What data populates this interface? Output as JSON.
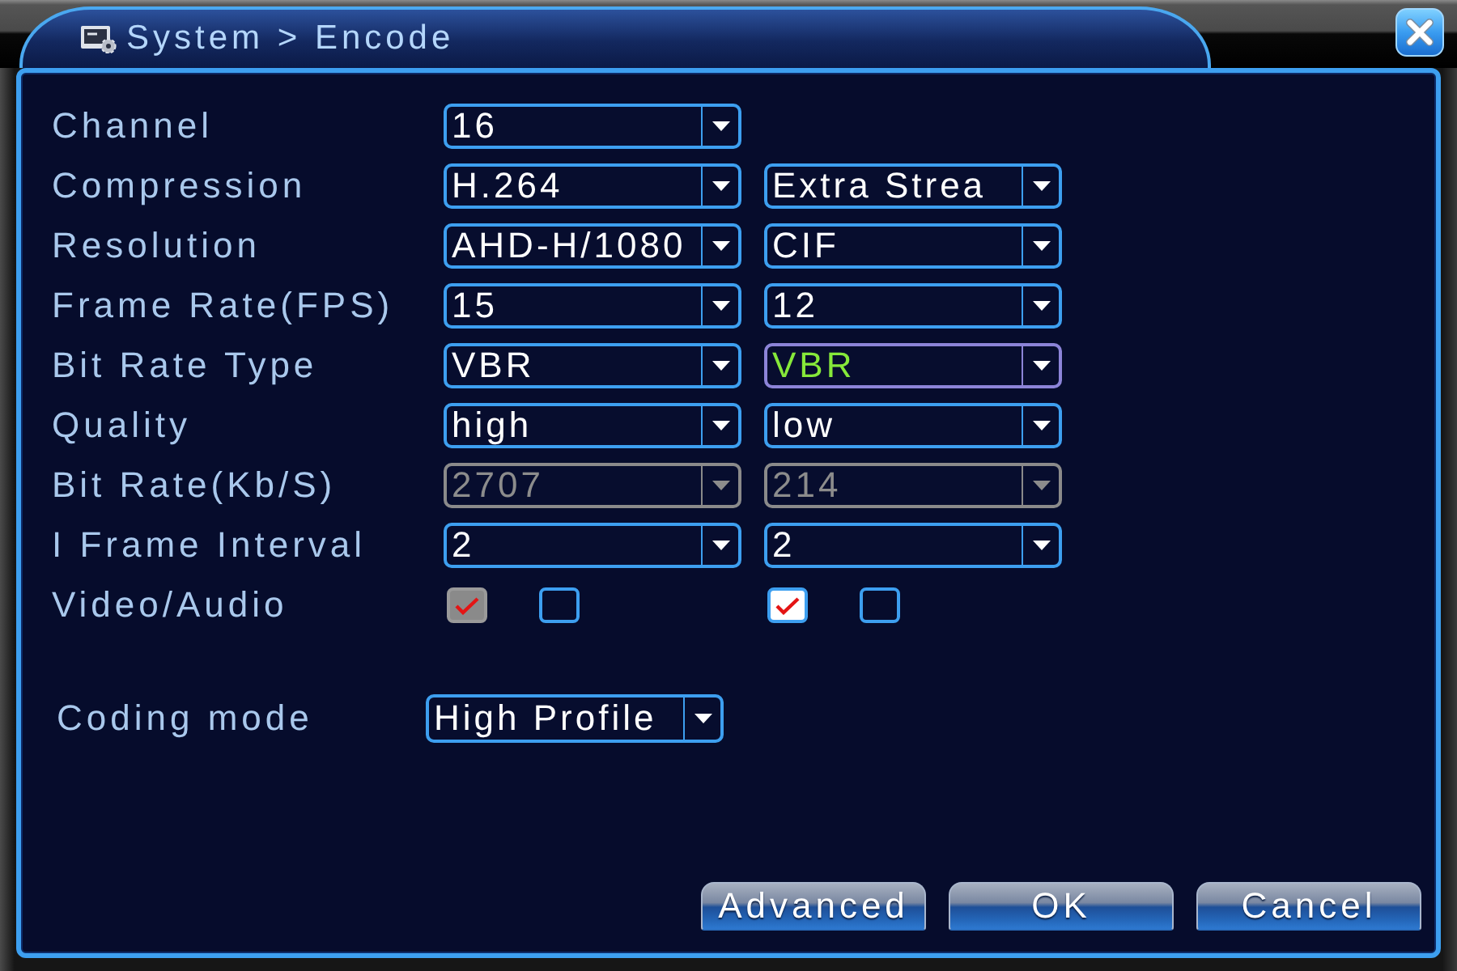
{
  "window": {
    "title": "System > Encode"
  },
  "fields": [
    {
      "label": "Channel",
      "controls": [
        {
          "kind": "select",
          "value": "16",
          "disabled": false,
          "focused": false
        }
      ]
    },
    {
      "label": "Compression",
      "controls": [
        {
          "kind": "select",
          "value": "H.264",
          "disabled": false,
          "focused": false
        },
        {
          "kind": "select",
          "value": "Extra Strea",
          "disabled": false,
          "focused": false
        }
      ]
    },
    {
      "label": "Resolution",
      "controls": [
        {
          "kind": "select",
          "value": "AHD-H/1080",
          "disabled": false,
          "focused": false
        },
        {
          "kind": "select",
          "value": "CIF",
          "disabled": false,
          "focused": false
        }
      ]
    },
    {
      "label": "Frame Rate(FPS)",
      "controls": [
        {
          "kind": "select",
          "value": "15",
          "disabled": false,
          "focused": false
        },
        {
          "kind": "select",
          "value": "12",
          "disabled": false,
          "focused": false
        }
      ]
    },
    {
      "label": "Bit Rate Type",
      "controls": [
        {
          "kind": "select",
          "value": "VBR",
          "disabled": false,
          "focused": false
        },
        {
          "kind": "select",
          "value": "VBR",
          "disabled": false,
          "focused": true
        }
      ]
    },
    {
      "label": "Quality",
      "controls": [
        {
          "kind": "select",
          "value": "high",
          "disabled": false,
          "focused": false
        },
        {
          "kind": "select",
          "value": "low",
          "disabled": false,
          "focused": false
        }
      ]
    },
    {
      "label": "Bit Rate(Kb/S)",
      "controls": [
        {
          "kind": "select",
          "value": "2707",
          "disabled": true,
          "focused": false
        },
        {
          "kind": "select",
          "value": "214",
          "disabled": true,
          "focused": false
        }
      ]
    },
    {
      "label": "I Frame Interval",
      "controls": [
        {
          "kind": "select",
          "value": "2",
          "disabled": false,
          "focused": false
        },
        {
          "kind": "select",
          "value": "2",
          "disabled": false,
          "focused": false
        }
      ]
    },
    {
      "label": "Video/Audio",
      "controls": [
        {
          "kind": "checkboxes",
          "boxes": [
            {
              "checked": true,
              "disabled": true
            },
            {
              "checked": false,
              "disabled": false
            }
          ]
        },
        {
          "kind": "checkboxes",
          "boxes": [
            {
              "checked": true,
              "disabled": false
            },
            {
              "checked": false,
              "disabled": false
            }
          ]
        }
      ]
    }
  ],
  "coding_mode": {
    "label": "Coding mode",
    "value": "High Profile"
  },
  "buttons": [
    "Advanced",
    "OK",
    "Cancel"
  ]
}
